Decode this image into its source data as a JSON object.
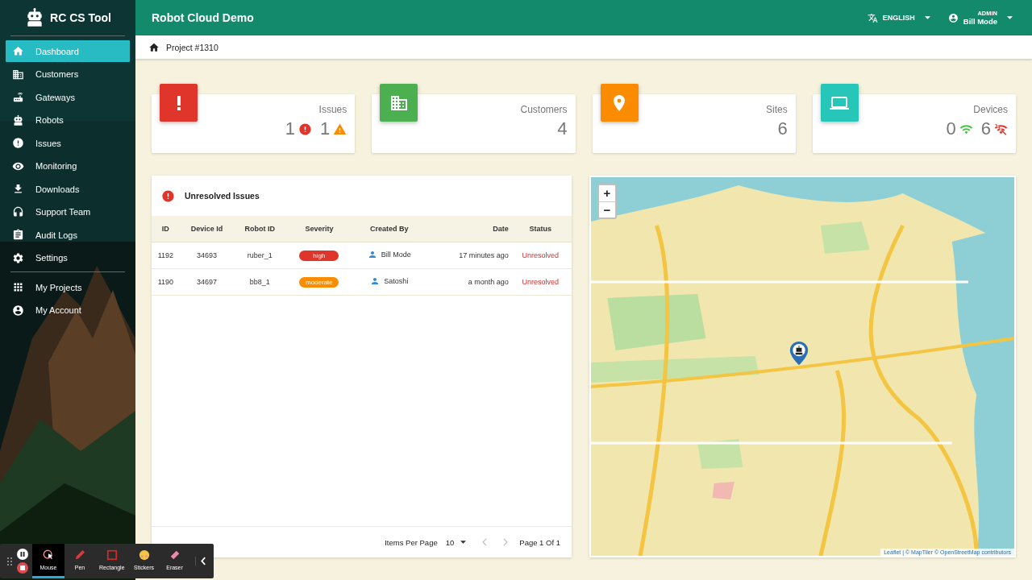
{
  "app": {
    "name": "RC CS Tool"
  },
  "sidebar": {
    "items": [
      {
        "label": "Dashboard",
        "kind": "home",
        "selected": true
      },
      {
        "label": "Customers",
        "kind": "building",
        "selected": false
      },
      {
        "label": "Gateways",
        "kind": "router",
        "selected": false
      },
      {
        "label": "Robots",
        "kind": "robot",
        "selected": false
      },
      {
        "label": "Issues",
        "kind": "error",
        "selected": false
      },
      {
        "label": "Monitoring",
        "kind": "eye",
        "selected": false
      },
      {
        "label": "Downloads",
        "kind": "download",
        "selected": false
      },
      {
        "label": "Support Team",
        "kind": "headset",
        "selected": false
      },
      {
        "label": "Audit Logs",
        "kind": "clipboard",
        "selected": false
      },
      {
        "label": "Settings",
        "kind": "settings",
        "selected": false
      }
    ],
    "secondary_items": [
      {
        "label": "My Projects",
        "kind": "grid",
        "selected": false
      },
      {
        "label": "My Account",
        "kind": "account",
        "selected": false
      }
    ]
  },
  "topbar": {
    "title": "Robot Cloud Demo",
    "language": "ENGLISH",
    "user": {
      "role": "ADMIN",
      "name": "Bill Mode"
    }
  },
  "breadcrumb": {
    "label": "Project #1310"
  },
  "stats": [
    {
      "label": "Issues",
      "kind": "exclamation",
      "color": "#e0352b",
      "values": [
        {
          "value": "1",
          "kind": "error"
        },
        {
          "value": "1",
          "kind": "warning"
        }
      ]
    },
    {
      "label": "Customers",
      "kind": "building",
      "color": "#4caf50",
      "values": [
        {
          "value": "4"
        }
      ]
    },
    {
      "label": "Sites",
      "kind": "pin",
      "color": "#fb8c00",
      "values": [
        {
          "value": "6"
        }
      ]
    },
    {
      "label": "Devices",
      "kind": "laptop",
      "color": "#26c6b9",
      "values": [
        {
          "value": "0",
          "kind": "wifi"
        },
        {
          "value": "6",
          "kind": "wifi_off"
        }
      ]
    }
  ],
  "issues": {
    "title": "Unresolved Issues",
    "columns": [
      "ID",
      "Device Id",
      "Robot ID",
      "Severity",
      "Created By",
      "Date",
      "Status"
    ],
    "rows": [
      {
        "id": "1192",
        "device_id": "34693",
        "robot_id": "ruber_1",
        "severity": {
          "label": "high",
          "kind": "high"
        },
        "created_by": "Bill Mode",
        "date": "17 minutes ago",
        "status": "Unresolved"
      },
      {
        "id": "1190",
        "device_id": "34697",
        "robot_id": "bb8_1",
        "severity": {
          "label": "moderate",
          "kind": "moderate"
        },
        "created_by": "Satoshi",
        "date": "a month ago",
        "status": "Unresolved"
      }
    ],
    "pagination": {
      "label": "Items Per Page",
      "per_page": "10",
      "page": "Page 1 Of 1"
    }
  },
  "map": {
    "zoom_in": "+",
    "zoom_out": "−",
    "attribution": "Leaflet | © MapTiler © OpenStreetMap contributors"
  },
  "recorder": {
    "tools": [
      {
        "label": "Mouse",
        "kind": "mouse",
        "selected": true
      },
      {
        "label": "Pen",
        "kind": "pen",
        "selected": false
      },
      {
        "label": "Rectangle",
        "kind": "rectangle",
        "selected": false
      },
      {
        "label": "Stickers",
        "kind": "stickers",
        "selected": false
      },
      {
        "label": "Eraser",
        "kind": "eraser",
        "selected": false
      }
    ]
  }
}
